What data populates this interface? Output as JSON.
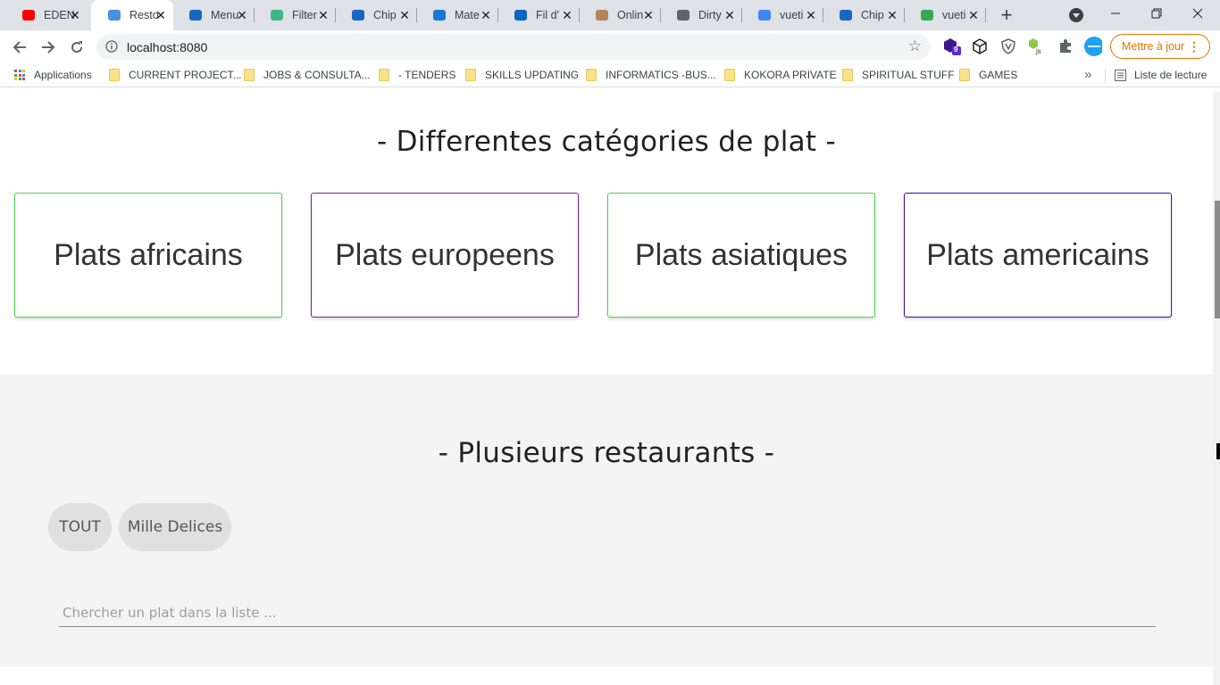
{
  "tabs": [
    {
      "title": "EDEN",
      "icon": "youtube-icon",
      "color": "#ff0000"
    },
    {
      "title": "Resto",
      "icon": "restaurant-favicon",
      "color": "#4a90e2",
      "active": true
    },
    {
      "title": "Menu",
      "icon": "vuetify-icon",
      "color": "#1867c0"
    },
    {
      "title": "Filter",
      "icon": "vue-icon",
      "color": "#41b883"
    },
    {
      "title": "Chip",
      "icon": "vuetify-icon",
      "color": "#1867c0"
    },
    {
      "title": "Mate",
      "icon": "material-icon",
      "color": "#1976d2"
    },
    {
      "title": "Fil d'",
      "icon": "linkedin-icon",
      "color": "#0a66c2"
    },
    {
      "title": "Onlin",
      "icon": "package-icon",
      "color": "#b5835a"
    },
    {
      "title": "Dirty",
      "icon": "code-icon",
      "color": "#5f6368"
    },
    {
      "title": "vueti",
      "icon": "google-icon",
      "color": "#4285f4"
    },
    {
      "title": "Chip",
      "icon": "vuetify-icon",
      "color": "#1867c0"
    },
    {
      "title": "vueti",
      "icon": "ycombinator-icon",
      "color": "#34a853"
    }
  ],
  "address": {
    "url": "localhost:8080"
  },
  "update_button": {
    "label": "Mettre à jour",
    "color": "#e37400"
  },
  "extension_badge": "9",
  "bookmarks": {
    "apps_label": "Applications",
    "items": [
      "CURRENT PROJECT...",
      "JOBS & CONSULTA...",
      "- TENDERS",
      "SKILLS UPDATING",
      "INFORMATICS -BUS...",
      "KOKORA PRIVATE",
      "SPIRITUAL STUFF",
      "GAMES"
    ],
    "reading_list": "Liste de lecture"
  },
  "categories_section": {
    "title": "- Differentes catégories de plat -",
    "cards": [
      {
        "label": "Plats africains",
        "border_color": "#4cd24c"
      },
      {
        "label": "Plats europeens",
        "border_color": "#8b1a8b"
      },
      {
        "label": "Plats asiatiques",
        "border_color": "#4cd24c"
      },
      {
        "label": "Plats americains",
        "border_color": "#3a0ca3"
      }
    ]
  },
  "restaurants_section": {
    "title": "- Plusieurs restaurants -",
    "chips": [
      "TOUT",
      "Mille Delices"
    ],
    "search_placeholder": "Chercher un plat dans la liste ..."
  }
}
